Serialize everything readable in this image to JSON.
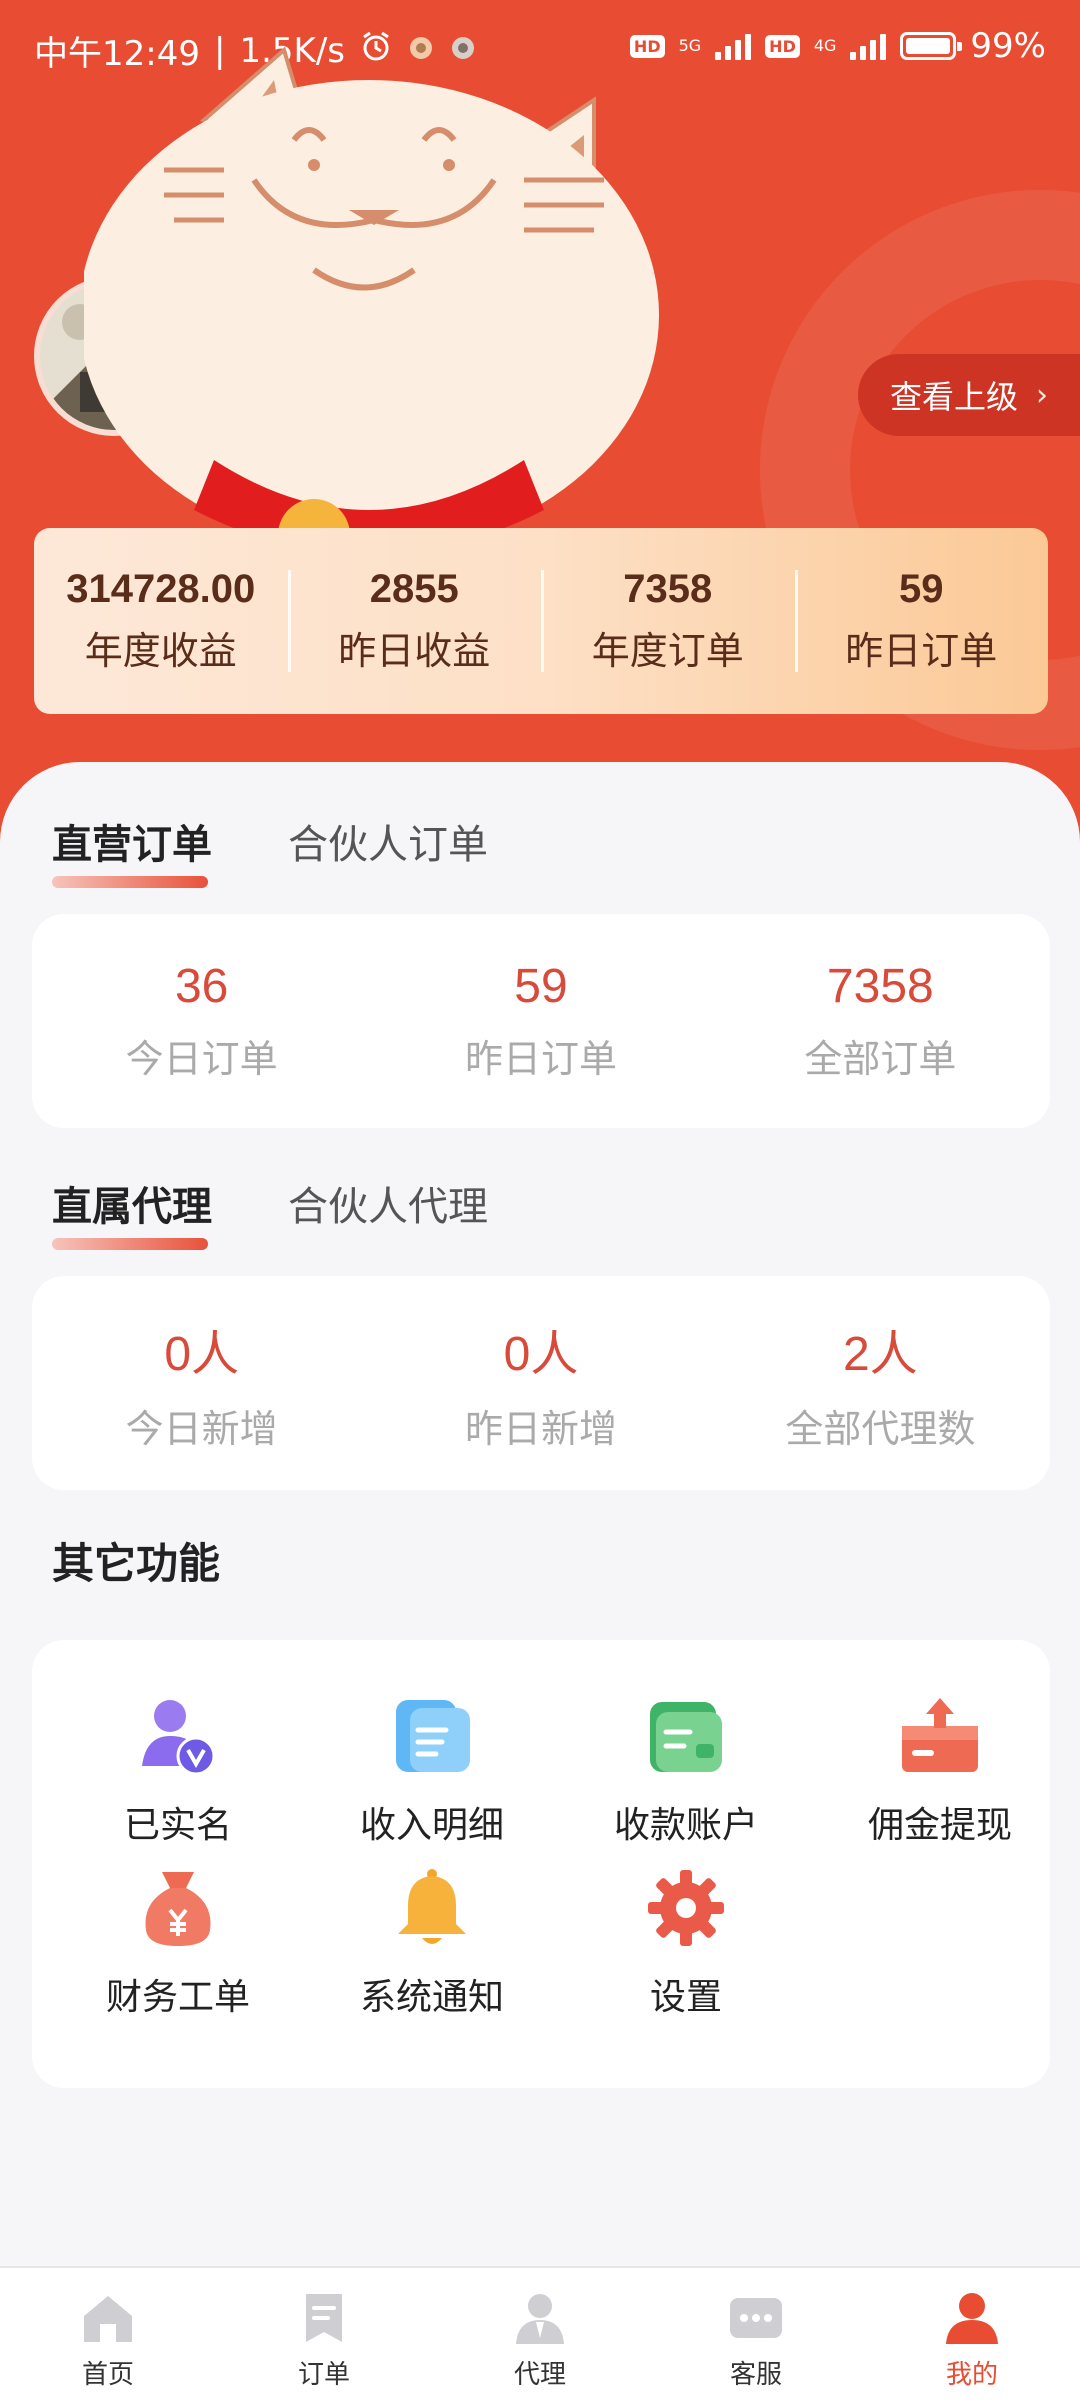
{
  "status_bar": {
    "time": "中午12:49",
    "net_speed": "1.5K/s",
    "hd_label": "HD",
    "net1": "5G",
    "net2": "4G",
    "battery": "99%"
  },
  "header": {
    "upline_button": "查看上级"
  },
  "summary": [
    {
      "value": "314728.00",
      "label": "年度收益"
    },
    {
      "value": "2855",
      "label": "昨日收益"
    },
    {
      "value": "7358",
      "label": "年度订单"
    },
    {
      "value": "59",
      "label": "昨日订单"
    }
  ],
  "orders": {
    "tabs": [
      "直营订单",
      "合伙人订单"
    ],
    "metrics": [
      {
        "value": "36",
        "label": "今日订单"
      },
      {
        "value": "59",
        "label": "昨日订单"
      },
      {
        "value": "7358",
        "label": "全部订单"
      }
    ]
  },
  "agents": {
    "tabs": [
      "直属代理",
      "合伙人代理"
    ],
    "metrics": [
      {
        "value": "0人",
        "label": "今日新增"
      },
      {
        "value": "0人",
        "label": "昨日新增"
      },
      {
        "value": "2人",
        "label": "全部代理数"
      }
    ]
  },
  "functions": {
    "title": "其它功能",
    "items": [
      {
        "label": "已实名",
        "icon": "verified-user-icon"
      },
      {
        "label": "收入明细",
        "icon": "document-icon"
      },
      {
        "label": "收款账户",
        "icon": "wallet-icon"
      },
      {
        "label": "佣金提现",
        "icon": "withdraw-icon"
      },
      {
        "label": "财务工单",
        "icon": "money-bag-icon"
      },
      {
        "label": "系统通知",
        "icon": "bell-icon"
      },
      {
        "label": "设置",
        "icon": "gear-icon"
      }
    ]
  },
  "nav": [
    {
      "label": "首页",
      "icon": "home-icon"
    },
    {
      "label": "订单",
      "icon": "order-icon"
    },
    {
      "label": "代理",
      "icon": "agent-icon"
    },
    {
      "label": "客服",
      "icon": "chat-icon"
    },
    {
      "label": "我的",
      "icon": "profile-icon",
      "active": true
    }
  ],
  "colors": {
    "brand": "#e84d33",
    "metric_value": "#d84a3a",
    "summary_text": "#5a2c1a"
  }
}
